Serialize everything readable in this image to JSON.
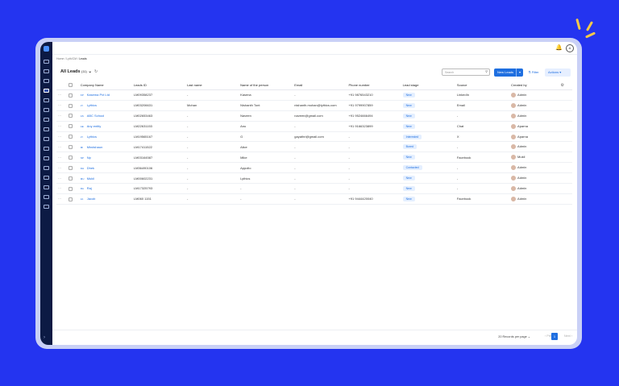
{
  "app": {
    "breadcrumbs": [
      "Home",
      "Lyth/CM",
      "Leads"
    ],
    "avatar_initial": "A",
    "bell_icon": "bell-icon"
  },
  "toolbar": {
    "title": "All Leads",
    "count": "(11)",
    "search_placeholder": "Search",
    "new_leads_label": "New Leads",
    "filter_label": "Filter",
    "actions_label": "Actions"
  },
  "table": {
    "columns": [
      "Company Name",
      "Leads ID",
      "Last name",
      "Name of the person",
      "Email",
      "Phone number",
      "Lead stage",
      "Source",
      "Created by"
    ],
    "rows": [
      {
        "initials": "KP",
        "company": "Kasema Pvt Ltd",
        "id": "LM09358237",
        "last": "-",
        "person": "Kasena",
        "email": "-",
        "phone": "+91 9876543210",
        "stage": "New",
        "source": "LinkedIn",
        "created": "Admin"
      },
      {
        "initials": "LY",
        "company": "Lythics",
        "id": "LM03206631",
        "last": "Mohan",
        "person": "Nishanth Tont",
        "email": "nishanth.mohan@lythics.com",
        "phone": "+91 9799907859",
        "stage": "New",
        "source": "Email",
        "created": "Admin"
      },
      {
        "initials": "AS",
        "company": "ABC School",
        "id": "LM02653463",
        "last": "-",
        "person": "Naveen",
        "email": "naveen@gmail.com",
        "phone": "+91 9524666494",
        "stage": "New",
        "source": "-",
        "created": "Admin"
      },
      {
        "initials": "AE",
        "company": "Any entity",
        "id": "LM22631153",
        "last": "-",
        "person": "Anu",
        "email": "-",
        "phone": "+91 9166323899",
        "stage": "New",
        "source": "Chat",
        "created": "Aparna"
      },
      {
        "initials": "LY",
        "company": "Lythics",
        "id": "LM19565167",
        "last": "-",
        "person": "G",
        "email": "gayathri@gmail.com",
        "phone": "-",
        "stage": "Interested",
        "source": "X",
        "created": "Aparna"
      },
      {
        "initials": "MI",
        "company": "Mindshaun",
        "id": "LM17411522",
        "last": "-",
        "person": "Alice",
        "email": "-",
        "phone": "-",
        "stage": "Bored",
        "source": "-",
        "created": "Admin"
      },
      {
        "initials": "NP",
        "company": "Np",
        "id": "LM03164587",
        "last": "-",
        "person": "Mike",
        "email": "-",
        "phone": "-",
        "stage": "New",
        "source": "Facebook",
        "created": "Mukil"
      },
      {
        "initials": "DH",
        "company": "Dhek",
        "id": "LM36490106",
        "last": "-",
        "person": "Appollo",
        "email": "-",
        "phone": "-",
        "stage": "Contacted",
        "source": "-",
        "created": "Admin"
      },
      {
        "initials": "MU",
        "company": "Mukil",
        "id": "LM00602231",
        "last": "-",
        "person": "Lythics",
        "email": "-",
        "phone": "-",
        "stage": "New",
        "source": "-",
        "created": "Admin"
      },
      {
        "initials": "RA",
        "company": "Raj",
        "id": "LM17325793",
        "last": "-",
        "person": "-",
        "email": "-",
        "phone": "-",
        "stage": "New",
        "source": "-",
        "created": "Admin"
      },
      {
        "initials": "JA",
        "company": "Jacob",
        "id": "LM060 1151",
        "last": "-",
        "person": "-",
        "email": "-",
        "phone": "+91 9444420040",
        "stage": "New",
        "source": "Facebook",
        "created": "Admin"
      }
    ]
  },
  "footer": {
    "records_per_page": "20 Records per page",
    "prev": "Prev",
    "page": "1",
    "next": "Next"
  }
}
